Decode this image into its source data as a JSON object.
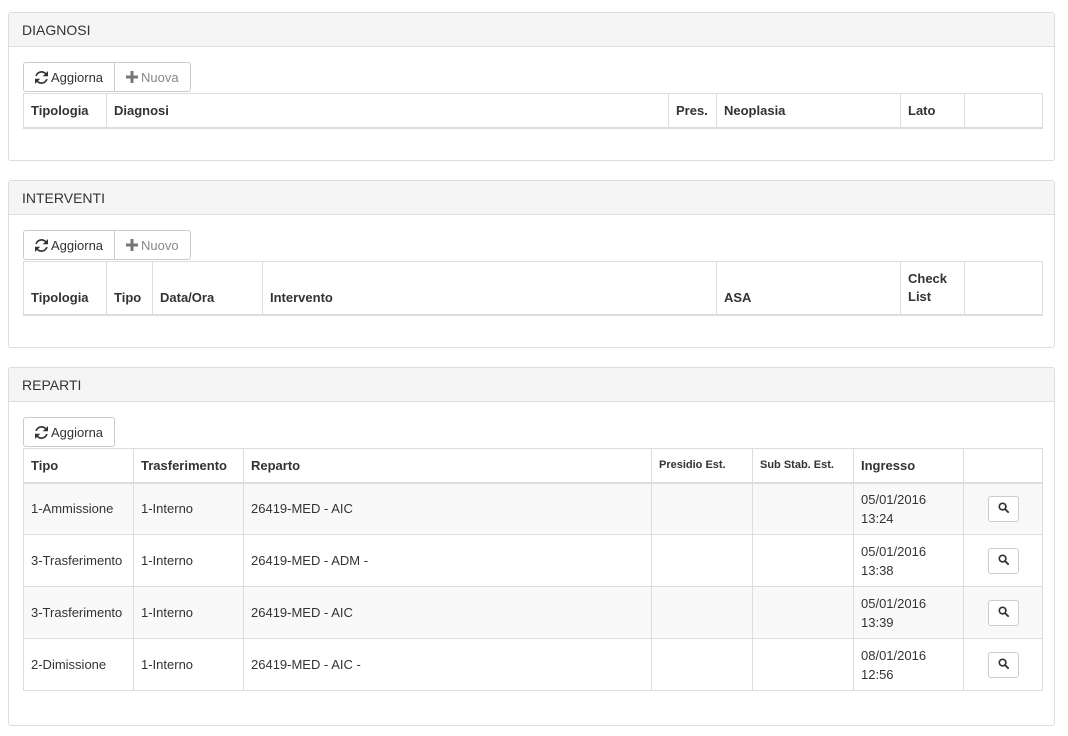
{
  "diagnosi": {
    "title": "DIAGNOSI",
    "refresh_label": "Aggiorna",
    "new_label": "Nuova",
    "columns": [
      "Tipologia",
      "Diagnosi",
      "Pres.",
      "Neoplasia",
      "Lato",
      ""
    ]
  },
  "interventi": {
    "title": "INTERVENTI",
    "refresh_label": "Aggiorna",
    "new_label": "Nuovo",
    "columns": [
      "Tipologia",
      "Tipo",
      "Data/Ora",
      "Intervento",
      "ASA",
      "Check List",
      ""
    ]
  },
  "reparti": {
    "title": "REPARTI",
    "refresh_label": "Aggiorna",
    "columns": [
      "Tipo",
      "Trasferimento",
      "Reparto",
      "Presidio Est.",
      "Sub Stab. Est.",
      "Ingresso",
      ""
    ],
    "rows": [
      {
        "tipo": "1-Ammissione",
        "trasferimento": "1-Interno",
        "reparto": "26419-MED - AIC",
        "presidio": "",
        "sub": "",
        "date": "05/01/2016",
        "time": "13:24"
      },
      {
        "tipo": "3-Trasferimento",
        "trasferimento": "1-Interno",
        "reparto": "26419-MED - ADM -",
        "presidio": "",
        "sub": "",
        "date": "05/01/2016",
        "time": "13:38"
      },
      {
        "tipo": "3-Trasferimento",
        "trasferimento": "1-Interno",
        "reparto": "26419-MED - AIC",
        "presidio": "",
        "sub": "",
        "date": "05/01/2016",
        "time": "13:39"
      },
      {
        "tipo": "2-Dimissione",
        "trasferimento": "1-Interno",
        "reparto": "26419-MED - AIC -",
        "presidio": "",
        "sub": "",
        "date": "08/01/2016",
        "time": "12:56"
      }
    ]
  },
  "icons": {
    "refresh": "refresh-icon",
    "plus": "plus-icon",
    "search": "search-icon"
  }
}
